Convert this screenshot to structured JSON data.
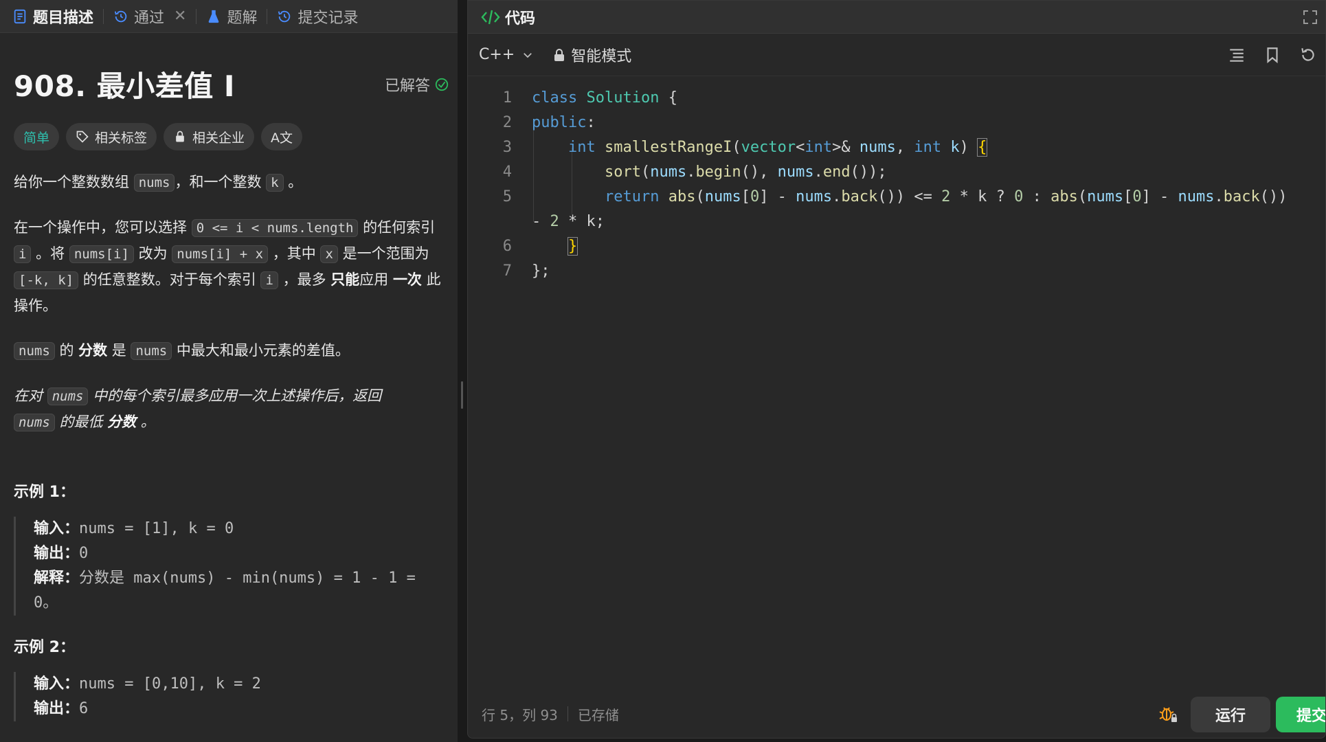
{
  "tabs": [
    {
      "label": "题目描述",
      "icon": "document-icon"
    },
    {
      "label": "通过",
      "icon": "history-icon"
    },
    {
      "label": "题解",
      "icon": "flask-icon"
    },
    {
      "label": "提交记录",
      "icon": "history-icon"
    }
  ],
  "problem": {
    "title": "908. 最小差值 I",
    "status": "已解答",
    "tags": {
      "difficulty": "简单",
      "topics": "相关标签",
      "companies": "相关企业",
      "translate": "A文"
    }
  },
  "description": {
    "p1": {
      "a": "给你一个整数数组 ",
      "b": "nums",
      "c": "，和一个整数 ",
      "d": "k",
      "e": " 。"
    },
    "p2": {
      "a": "在一个操作中，您可以选择 ",
      "b": "0 <= i < nums.length",
      "c": " 的任何索引 ",
      "d": "i",
      "e": " 。将 ",
      "f": "nums[i]",
      "g": " 改为 ",
      "h": "nums[i] + x",
      "i": " ，其中 ",
      "j": "x",
      "k": " 是一个范围为 ",
      "l": "[-k, k]",
      "m": " 的任意整数。对于每个索引 ",
      "n": "i",
      "o": " ，最多 ",
      "p": "只能",
      "q": "应用 ",
      "r": "一次",
      "s": " 此操作。"
    },
    "p3": {
      "a": "nums",
      "b": " 的 ",
      "c": "分数",
      "d": " 是 ",
      "e": "nums",
      "f": " 中最大和最小元素的差值。"
    },
    "p4": {
      "a": "在对 ",
      "b": "nums",
      "c": " 中的每个索引最多应用一次上述操作后，返回 ",
      "d": "nums",
      "e": " 的最低 ",
      "f": "分数",
      "g": " 。"
    }
  },
  "examples": [
    {
      "title": "示例 1：",
      "input_label": "输入：",
      "input": "nums = [1], k = 0",
      "output_label": "输出：",
      "output": "0",
      "explain_label": "解释：",
      "explain": "分数是 max(nums) - min(nums) = 1 - 1 = 0。"
    },
    {
      "title": "示例 2：",
      "input_label": "输入：",
      "input": "nums = [0,10], k = 2",
      "output_label": "输出：",
      "output": "6"
    }
  ],
  "editor": {
    "header_label": "代码",
    "language": "C++",
    "mode": "智能模式",
    "line_numbers": [
      "1",
      "2",
      "3",
      "4",
      "5",
      "6",
      "7"
    ],
    "status_position": "行 5，列 93",
    "status_saved": "已存储",
    "run_label": "运行",
    "submit_label": "提交"
  },
  "colors": {
    "accent_green": "#2cbb5d",
    "easy_teal": "#2ebfad",
    "background": "#282828"
  }
}
